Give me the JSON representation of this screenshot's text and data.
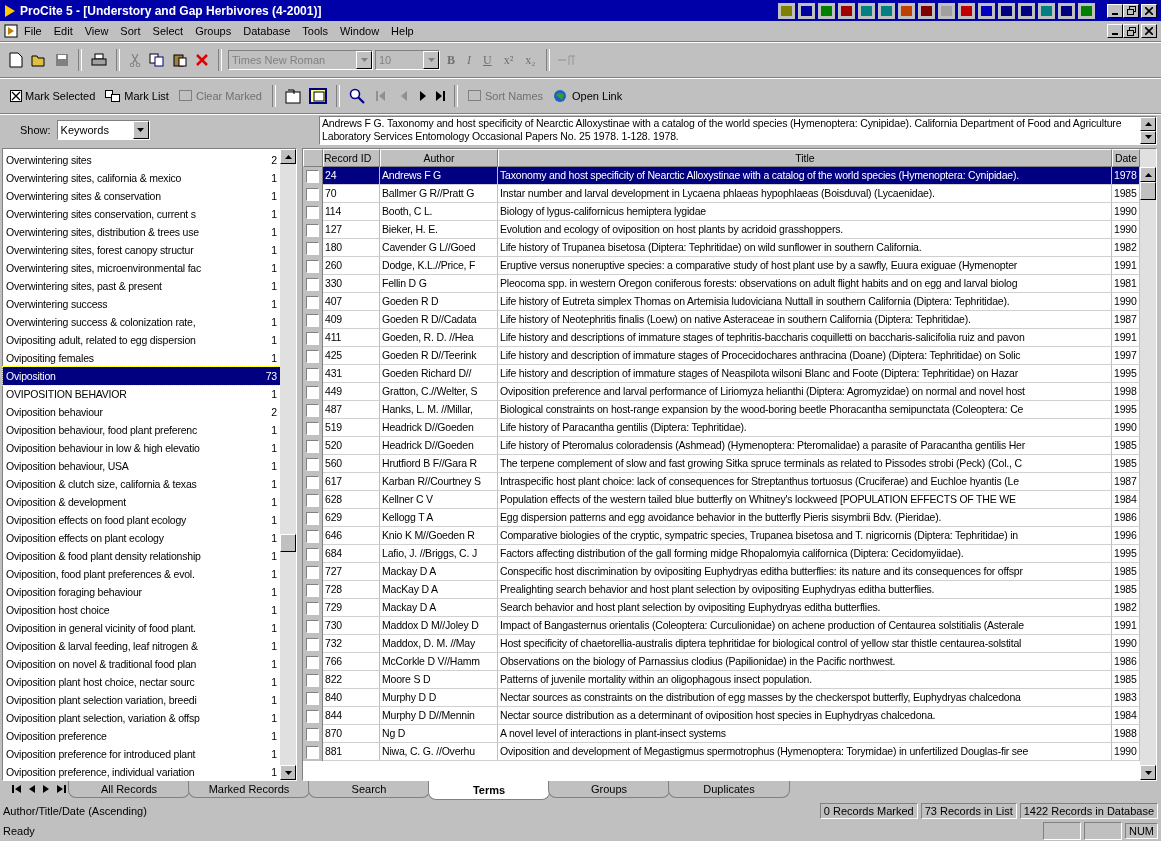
{
  "window": {
    "title": "ProCite 5 - [Understory and Gap Herbivores (4-2001)]"
  },
  "menu": [
    "File",
    "Edit",
    "View",
    "Sort",
    "Select",
    "Groups",
    "Database",
    "Tools",
    "Window",
    "Help"
  ],
  "format_bar": {
    "font": "Times New Roman",
    "size": "10",
    "styles": [
      "B",
      "I",
      "U",
      "x²",
      "x₂"
    ]
  },
  "action_bar": [
    {
      "kind": "text",
      "label": "Mark Selected",
      "disabled": false
    },
    {
      "kind": "text",
      "label": "Mark List",
      "disabled": false
    },
    {
      "kind": "text",
      "label": "Clear Marked",
      "disabled": true
    },
    {
      "kind": "nav",
      "disabled": true
    },
    {
      "kind": "text",
      "label": "Sort Names",
      "disabled": true
    },
    {
      "kind": "text",
      "label": "Open Link",
      "disabled": false
    }
  ],
  "show": {
    "label": "Show:",
    "value": "Keywords"
  },
  "preview": "Andrews F G.  Taxonomy and host specificity of Nearctic Alloxystinae with a catalog of the world species (Hymenoptera: Cynipidae). California Department of Food and Agriculture Laboratory Services Entomology Occasional Papers No. 25 1978. 1-128. 1978.",
  "terms": [
    {
      "term": "Overwintering sites",
      "count": "2",
      "selected": false
    },
    {
      "term": "Overwintering sites, california & mexico",
      "count": "1",
      "selected": false
    },
    {
      "term": "Overwintering sites & conservation",
      "count": "1",
      "selected": false
    },
    {
      "term": "Overwintering sites conservation, current s",
      "count": "1",
      "selected": false
    },
    {
      "term": "Overwintering sites, distribution & trees use",
      "count": "1",
      "selected": false
    },
    {
      "term": "Overwintering sites, forest canopy structur",
      "count": "1",
      "selected": false
    },
    {
      "term": "Overwintering sites, microenvironmental fac",
      "count": "1",
      "selected": false
    },
    {
      "term": "Overwintering sites, past & present",
      "count": "1",
      "selected": false
    },
    {
      "term": "Overwintering success",
      "count": "1",
      "selected": false
    },
    {
      "term": "Overwintering success & colonization rate,",
      "count": "1",
      "selected": false
    },
    {
      "term": "Ovipositing adult, related to egg dispersion",
      "count": "1",
      "selected": false
    },
    {
      "term": "Ovipositing females",
      "count": "1",
      "selected": false
    },
    {
      "term": "Oviposition",
      "count": "73",
      "selected": true
    },
    {
      "term": "OVIPOSITION BEHAVIOR",
      "count": "1",
      "selected": false
    },
    {
      "term": "Oviposition behaviour",
      "count": "2",
      "selected": false
    },
    {
      "term": "Oviposition behaviour, food plant preferenc",
      "count": "1",
      "selected": false
    },
    {
      "term": "Oviposition behaviour in low & high elevatio",
      "count": "1",
      "selected": false
    },
    {
      "term": "Oviposition behaviour, USA",
      "count": "1",
      "selected": false
    },
    {
      "term": "Oviposition & clutch size, california & texas",
      "count": "1",
      "selected": false
    },
    {
      "term": "Oviposition & development",
      "count": "1",
      "selected": false
    },
    {
      "term": "Oviposition effects on food plant ecology",
      "count": "1",
      "selected": false
    },
    {
      "term": "Oviposition effects on plant ecology",
      "count": "1",
      "selected": false
    },
    {
      "term": "Oviposition & food plant density relationship",
      "count": "1",
      "selected": false
    },
    {
      "term": "Oviposition, food plant preferences & evol.",
      "count": "1",
      "selected": false
    },
    {
      "term": "Oviposition foraging behaviour",
      "count": "1",
      "selected": false
    },
    {
      "term": "Oviposition host choice",
      "count": "1",
      "selected": false
    },
    {
      "term": "Oviposition in general vicinity of food plant.",
      "count": "1",
      "selected": false
    },
    {
      "term": "Oviposition & larval feeding, leaf nitrogen &",
      "count": "1",
      "selected": false
    },
    {
      "term": "Oviposition on novel & traditional food plan",
      "count": "1",
      "selected": false
    },
    {
      "term": "Oviposition plant host choice, nectar sourc",
      "count": "1",
      "selected": false
    },
    {
      "term": "Oviposition plant selection variation, breedi",
      "count": "1",
      "selected": false
    },
    {
      "term": "Oviposition plant selection, variation & offsp",
      "count": "1",
      "selected": false
    },
    {
      "term": "Oviposition preference",
      "count": "1",
      "selected": false
    },
    {
      "term": "Oviposition preference for introduced plant",
      "count": "1",
      "selected": false
    },
    {
      "term": "Oviposition preference, individual variation",
      "count": "1",
      "selected": false
    }
  ],
  "table": {
    "columns": [
      "Record ID",
      "Author",
      "Title",
      "Date"
    ],
    "rows": [
      {
        "id": "24",
        "author": "Andrews F G",
        "title": "Taxonomy and host specificity of Nearctic Alloxystinae with a catalog of the world species (Hymenoptera: Cynipidae).",
        "date": "1978",
        "marked": false,
        "selected": true
      },
      {
        "id": "70",
        "author": "Ballmer G R//Pratt G",
        "title": "Instar number and larval development in Lycaena phlaeas hypophlaeas (Boisduval) (Lycaenidae).",
        "date": "1985",
        "marked": false,
        "selected": false
      },
      {
        "id": "114",
        "author": "Booth, C L.",
        "title": "Biology of lygus-californicus hemiptera lygidae",
        "date": "1990",
        "marked": false,
        "selected": false
      },
      {
        "id": "127",
        "author": "Bieker, H. E.",
        "title": "Evolution and ecology of oviposition on host plants by acridoid grasshoppers.",
        "date": "1990",
        "marked": false,
        "selected": false
      },
      {
        "id": "180",
        "author": "Cavender G L//Goed",
        "title": "Life history of Trupanea bisetosa (Diptera: Tephritidae) on wild sunflower in southern California.",
        "date": "1982",
        "marked": false,
        "selected": false
      },
      {
        "id": "260",
        "author": "Dodge, K.L.//Price, F",
        "title": "Eruptive versus noneruptive species: a comparative study of host plant use by a sawfly, Euura exiguae (Hymenopter",
        "date": "1991",
        "marked": false,
        "selected": false
      },
      {
        "id": "330",
        "author": "Fellin D G",
        "title": "Pleocoma spp. in western Oregon coniferous forests: observations on adult flight habits and on egg and larval biolog",
        "date": "1981",
        "marked": false,
        "selected": false
      },
      {
        "id": "407",
        "author": "Goeden R D",
        "title": "Life history of Eutreta simplex Thomas on Artemisia ludoviciana Nuttall in southern California (Diptera: Tephritidae).",
        "date": "1990",
        "marked": false,
        "selected": false
      },
      {
        "id": "409",
        "author": "Goeden R D//Cadata",
        "title": "Life history of Neotephritis finalis (Loew) on native Asteraceae in southern California (Diptera: Tephritidae).",
        "date": "1987",
        "marked": false,
        "selected": false
      },
      {
        "id": "411",
        "author": "Goeden, R. D. //Hea",
        "title": "Life history and descriptions of immature stages of tephritis-baccharis coquilletti on baccharis-salicifolia ruiz and pavon",
        "date": "1991",
        "marked": false,
        "selected": false
      },
      {
        "id": "425",
        "author": "Goeden R D//Teerink",
        "title": "Life history and description of immature stages of Procecidochares anthracina (Doane) (Diptera: Tephritidae) on Solic",
        "date": "1997",
        "marked": false,
        "selected": false
      },
      {
        "id": "431",
        "author": "Goeden Richard D//",
        "title": "Life history and description of immature stages of Neaspilota wilsoni Blanc and Foote (Diptera: Tephritidae) on Hazar",
        "date": "1995",
        "marked": false,
        "selected": false
      },
      {
        "id": "449",
        "author": "Gratton, C.//Welter, S",
        "title": "Oviposition preference and larval performance of Liriomyza helianthi (Diptera: Agromyzidae) on normal and novel host",
        "date": "1998",
        "marked": false,
        "selected": false
      },
      {
        "id": "487",
        "author": "Hanks, L. M. //Millar,",
        "title": "Biological constraints on host-range expansion by the wood-boring beetle Phoracantha semipunctata (Coleoptera: Ce",
        "date": "1995",
        "marked": false,
        "selected": false
      },
      {
        "id": "519",
        "author": "Headrick D//Goeden",
        "title": "Life history of Paracantha gentilis (Diptera: Tephritidae).",
        "date": "1990",
        "marked": false,
        "selected": false
      },
      {
        "id": "520",
        "author": "Headrick D//Goeden",
        "title": "Life history of Pteromalus coloradensis (Ashmead) (Hymenoptera: Pteromalidae) a parasite of Paracantha gentilis Her",
        "date": "1985",
        "marked": false,
        "selected": false
      },
      {
        "id": "560",
        "author": "Hrutfiord B F//Gara R",
        "title": "The terpene complement of slow and fast growing Sitka spruce terminals as related to Pissodes strobi (Peck) (Col., C",
        "date": "1985",
        "marked": false,
        "selected": false
      },
      {
        "id": "617",
        "author": "Karban R//Courtney S",
        "title": "Intraspecific host plant choice: lack of consequences for Streptanthus tortuosus (Cruciferae) and Euchloe hyantis (Le",
        "date": "1987",
        "marked": false,
        "selected": false
      },
      {
        "id": "628",
        "author": "Kellner C V",
        "title": "Population effects of the western tailed blue butterfly on Whitney's lockweed [POPULATION EFFECTS OF THE WE",
        "date": "1984",
        "marked": false,
        "selected": false
      },
      {
        "id": "629",
        "author": "Kellogg T A",
        "title": "Egg dispersion patterns and egg avoidance behavior in the butterfly Pieris sisymbrii Bdv. (Pieridae).",
        "date": "1986",
        "marked": false,
        "selected": false
      },
      {
        "id": "646",
        "author": "Knio K M//Goeden R",
        "title": "Comparative biologies of the cryptic, sympatric species, Trupanea bisetosa and T. nigricornis (Diptera: Tephritidae) in",
        "date": "1996",
        "marked": false,
        "selected": false
      },
      {
        "id": "684",
        "author": "Lafio, J. //Briggs, C. J",
        "title": "Factors affecting distribution of the gall forming midge Rhopalomyia californica (Diptera: Cecidomyiidae).",
        "date": "1995",
        "marked": false,
        "selected": false
      },
      {
        "id": "727",
        "author": "Mackay D A",
        "title": "Conspecific host discrimination by ovipositing Euphydryas editha butterflies: its nature and its consequences for offspr",
        "date": "1985",
        "marked": false,
        "selected": false
      },
      {
        "id": "728",
        "author": "MacKay D A",
        "title": "Prealighting search behavior and host plant selection by ovipositing Euphydryas editha butterflies.",
        "date": "1985",
        "marked": false,
        "selected": false
      },
      {
        "id": "729",
        "author": "Mackay D A",
        "title": "Search behavior and host plant selection by ovipositing Euphydryas editha butterflies.",
        "date": "1982",
        "marked": false,
        "selected": false
      },
      {
        "id": "730",
        "author": "Maddox D M//Joley D",
        "title": "Impact of Bangasternus orientalis (Coleoptera: Curculionidae) on achene production of Centaurea solstitialis (Asterale",
        "date": "1991",
        "marked": false,
        "selected": false
      },
      {
        "id": "732",
        "author": "Maddox, D. M. //May",
        "title": "Host specificity of chaetorellia-australis diptera tephritidae for biological control of yellow star thistle centaurea-solstital",
        "date": "1990",
        "marked": false,
        "selected": false
      },
      {
        "id": "766",
        "author": "McCorkle D V//Hamm",
        "title": "Observations on the biology of Parnassius clodius (Papilionidae) in the Pacific northwest.",
        "date": "1986",
        "marked": false,
        "selected": false
      },
      {
        "id": "822",
        "author": "Moore S D",
        "title": "Patterns of juvenile mortality within an oligophagous insect population.",
        "date": "1985",
        "marked": false,
        "selected": false
      },
      {
        "id": "840",
        "author": "Murphy D D",
        "title": "Nectar sources as constraints on the distribution of egg masses by the checkerspot butterfly, Euphydryas chalcedona",
        "date": "1983",
        "marked": false,
        "selected": false
      },
      {
        "id": "844",
        "author": "Murphy D D//Mennin",
        "title": "Nectar source distribution as a determinant of oviposition host species in Euphydryas chalcedona.",
        "date": "1984",
        "marked": false,
        "selected": false
      },
      {
        "id": "870",
        "author": "Ng D",
        "title": "A novel level of interactions in plant-insect systems",
        "date": "1988",
        "marked": false,
        "selected": false
      },
      {
        "id": "881",
        "author": "Niwa, C. G. //Overhu",
        "title": "Oviposition and development of Megastigmus spermotrophus (Hymenoptera: Torymidae) in unfertilized Douglas-fir see",
        "date": "1990",
        "marked": false,
        "selected": false
      }
    ]
  },
  "view_tabs": [
    {
      "label": "All Records",
      "selected": false
    },
    {
      "label": "Marked Records",
      "selected": false
    },
    {
      "label": "Search",
      "selected": false
    },
    {
      "label": "Terms",
      "selected": true
    },
    {
      "label": "Groups",
      "selected": false
    },
    {
      "label": "Duplicates",
      "selected": false
    }
  ],
  "status_bar": {
    "sort": "Author/Title/Date (Ascending)",
    "panels": [
      "0 Records Marked",
      "73 Records in List",
      "1422 Records in Database"
    ],
    "message": "Ready",
    "num": "NUM"
  }
}
